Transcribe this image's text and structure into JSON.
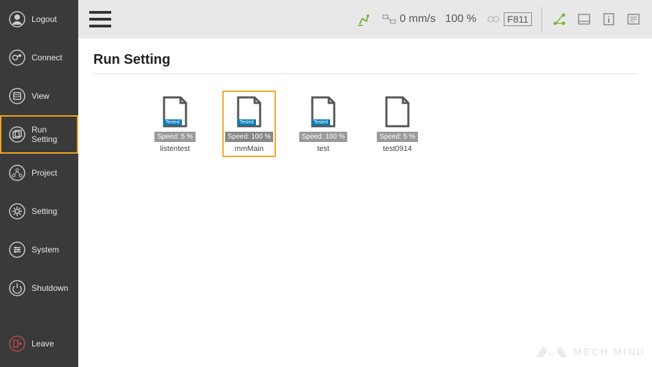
{
  "sidebar": {
    "items": [
      {
        "label": "Logout",
        "icon": "user-icon",
        "active": false
      },
      {
        "label": "Connect",
        "icon": "connect-icon",
        "active": false
      },
      {
        "label": "View",
        "icon": "view-icon",
        "active": false
      },
      {
        "label": "Run Setting",
        "icon": "run-setting-icon",
        "active": true
      },
      {
        "label": "Project",
        "icon": "project-icon",
        "active": false
      },
      {
        "label": "Setting",
        "icon": "gear-icon",
        "active": false
      },
      {
        "label": "System",
        "icon": "system-icon",
        "active": false
      },
      {
        "label": "Shutdown",
        "icon": "power-icon",
        "active": false
      }
    ],
    "leave": {
      "label": "Leave",
      "icon": "exit-icon"
    }
  },
  "topbar": {
    "speed": "0 mm/s",
    "percent": "100 %",
    "fcode": "F811"
  },
  "page": {
    "title": "Run Setting"
  },
  "programs": [
    {
      "name": "listentest",
      "speed": "Speed: 5 %",
      "tested": true,
      "selected": false
    },
    {
      "name": "mmMain",
      "speed": "Speed: 100 %",
      "tested": true,
      "selected": true
    },
    {
      "name": "test",
      "speed": "Speed: 100 %",
      "tested": true,
      "selected": false
    },
    {
      "name": "test0914",
      "speed": "Speed: 5 %",
      "tested": false,
      "selected": false
    }
  ],
  "watermark": "MECH MIND"
}
